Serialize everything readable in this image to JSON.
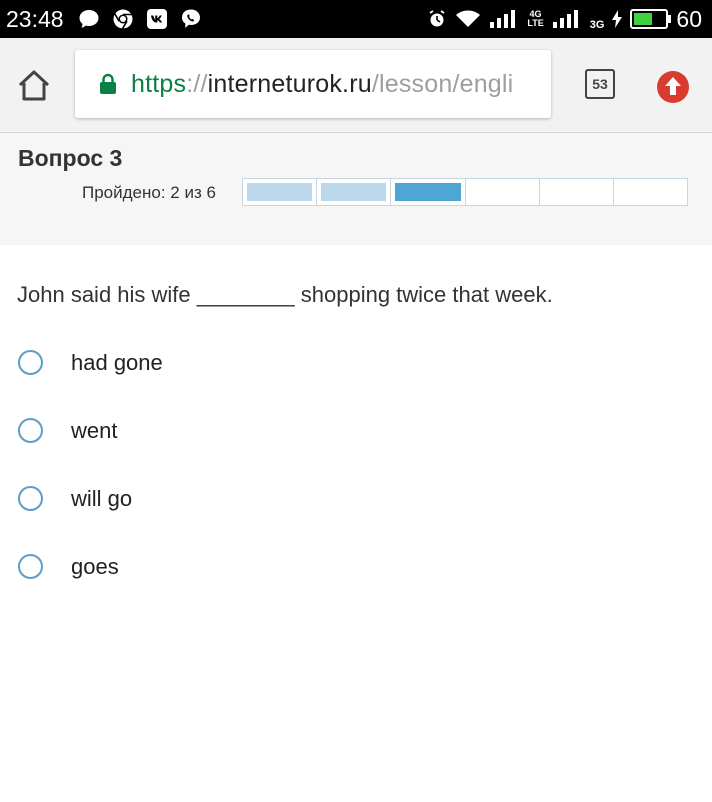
{
  "status_bar": {
    "time": "23:48",
    "battery_level": "60",
    "network_4g": "4G",
    "network_lte": "LTE",
    "network_3g": "3G",
    "icons": [
      "chat-bubble-icon",
      "chrome-icon",
      "vk-icon",
      "viber-icon",
      "alarm-icon",
      "wifi-icon",
      "signal-icon",
      "charging-icon",
      "battery-icon"
    ]
  },
  "browser": {
    "url_scheme": "https",
    "url_sep": "://",
    "url_host": "interneturok.ru",
    "url_path": "/lesson/engli",
    "tab_count": "53",
    "accent_green": "#0b8043",
    "update_red": "#d93b2f"
  },
  "quiz": {
    "title": "Вопрос 3",
    "progress_label": "Пройдено: 2 из 6",
    "segments": [
      "done",
      "done",
      "current",
      "todo",
      "todo",
      "todo"
    ],
    "question": "John said his wife ________ shopping twice that week.",
    "options": [
      "had gone",
      "went",
      "will go",
      "goes"
    ]
  }
}
